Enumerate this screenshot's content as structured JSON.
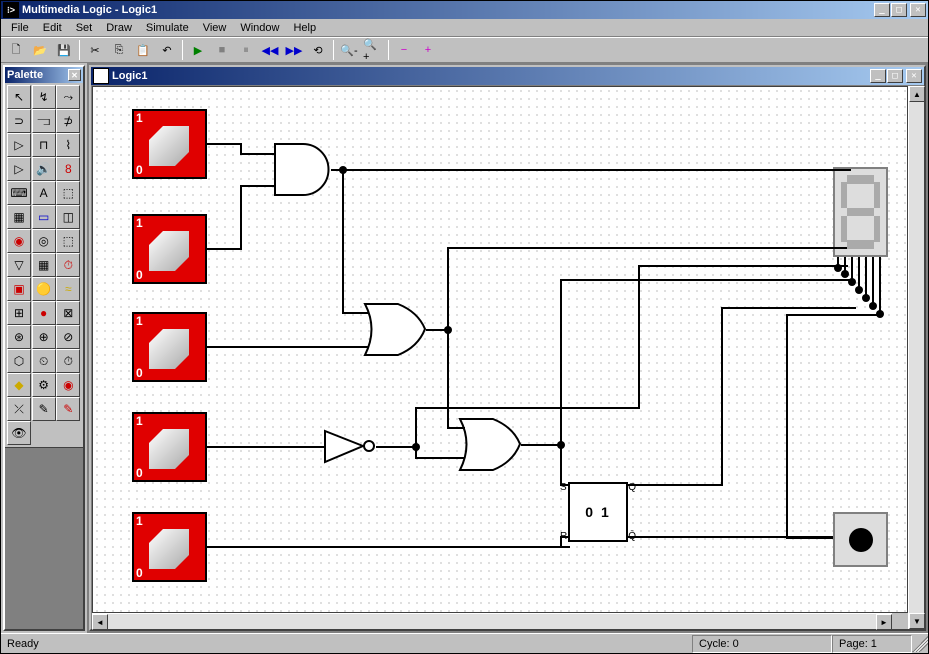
{
  "app": {
    "title": "Multimedia Logic - Logic1",
    "icon_glyph": "⁝>"
  },
  "menus": [
    "File",
    "Edit",
    "Set",
    "Draw",
    "Simulate",
    "View",
    "Window",
    "Help"
  ],
  "toolbar": {
    "new": "🗋",
    "open": "📂",
    "save": "💾",
    "cut": "✂",
    "copy": "⎘",
    "paste": "📋",
    "undo": "↶",
    "run": "▶",
    "stop": "■",
    "pause": "⏸",
    "step_back": "◀◀",
    "step": "▶▶",
    "reset": "⟲",
    "zoom_out": "🔍-",
    "zoom_in": "🔍+",
    "minus": "−",
    "plus": "+"
  },
  "palette": {
    "title": "Palette",
    "tools": [
      "↖",
      "↯",
      "⤳",
      "⊃",
      "⫎",
      "⊅",
      "▷",
      "⊓",
      "⌇",
      "▷",
      "🔊",
      "8",
      "⌨",
      "A",
      "⬚",
      "▦",
      "▭",
      "◫",
      "◉",
      "◎",
      "⬚",
      "▽",
      "▦",
      "⏱",
      "▣",
      "🟡",
      "≈",
      "⊞",
      "●",
      "⊠",
      "⊛",
      "⊕",
      "⊘",
      "⬡",
      "⏲",
      "⏱",
      "◆",
      "⚙",
      "◉",
      "⤫",
      "✎",
      "✎",
      "👁",
      "",
      ""
    ]
  },
  "child": {
    "title": "Logic1"
  },
  "circuit": {
    "switch_labels": {
      "high": "1",
      "low": "0"
    },
    "flipflop": {
      "display": "0 1",
      "s": "S",
      "r": "R",
      "q": "Q",
      "qbar": "Q̄"
    }
  },
  "status": {
    "ready": "Ready",
    "cycle": "Cycle: 0",
    "page": "Page: 1"
  }
}
